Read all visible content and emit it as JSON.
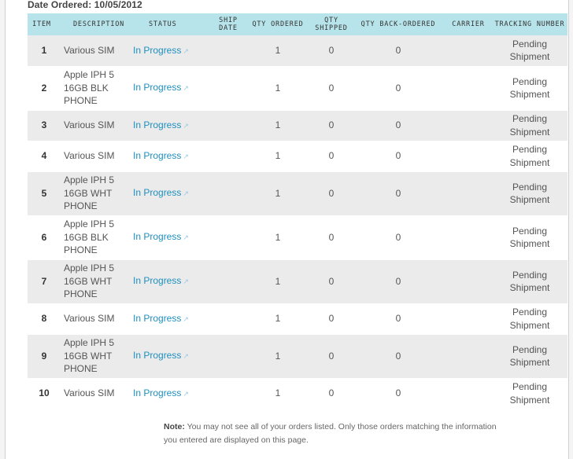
{
  "header": {
    "date_ordered_label": "Date Ordered:",
    "date_ordered_value": "10/05/2012"
  },
  "columns": {
    "item": "Item",
    "description": "Description",
    "status": "Status",
    "ship_date": "Ship Date",
    "qty_ordered": "Qty Ordered",
    "qty_shipped": "Qty Shipped",
    "qty_backordered": "Qty Back-Ordered",
    "carrier": "Carrier",
    "tracking": "Tracking Number"
  },
  "rows": [
    {
      "item": "1",
      "description": "Various SIM",
      "status": "In Progress",
      "ship_date": "",
      "qty_ordered": "1",
      "qty_shipped": "0",
      "qty_backordered": "0",
      "carrier": "",
      "tracking": "Pending Shipment"
    },
    {
      "item": "2",
      "description": "Apple IPH 5 16GB BLK PHONE",
      "status": "In Progress",
      "ship_date": "",
      "qty_ordered": "1",
      "qty_shipped": "0",
      "qty_backordered": "0",
      "carrier": "",
      "tracking": "Pending Shipment"
    },
    {
      "item": "3",
      "description": "Various SIM",
      "status": "In Progress",
      "ship_date": "",
      "qty_ordered": "1",
      "qty_shipped": "0",
      "qty_backordered": "0",
      "carrier": "",
      "tracking": "Pending Shipment"
    },
    {
      "item": "4",
      "description": "Various SIM",
      "status": "In Progress",
      "ship_date": "",
      "qty_ordered": "1",
      "qty_shipped": "0",
      "qty_backordered": "0",
      "carrier": "",
      "tracking": "Pending Shipment"
    },
    {
      "item": "5",
      "description": "Apple IPH 5 16GB WHT PHONE",
      "status": "In Progress",
      "ship_date": "",
      "qty_ordered": "1",
      "qty_shipped": "0",
      "qty_backordered": "0",
      "carrier": "",
      "tracking": "Pending Shipment"
    },
    {
      "item": "6",
      "description": "Apple IPH 5 16GB BLK PHONE",
      "status": "In Progress",
      "ship_date": "",
      "qty_ordered": "1",
      "qty_shipped": "0",
      "qty_backordered": "0",
      "carrier": "",
      "tracking": "Pending Shipment"
    },
    {
      "item": "7",
      "description": "Apple IPH 5 16GB WHT PHONE",
      "status": "In Progress",
      "ship_date": "",
      "qty_ordered": "1",
      "qty_shipped": "0",
      "qty_backordered": "0",
      "carrier": "",
      "tracking": "Pending Shipment"
    },
    {
      "item": "8",
      "description": "Various SIM",
      "status": "In Progress",
      "ship_date": "",
      "qty_ordered": "1",
      "qty_shipped": "0",
      "qty_backordered": "0",
      "carrier": "",
      "tracking": "Pending Shipment"
    },
    {
      "item": "9",
      "description": "Apple IPH 5 16GB WHT PHONE",
      "status": "In Progress",
      "ship_date": "",
      "qty_ordered": "1",
      "qty_shipped": "0",
      "qty_backordered": "0",
      "carrier": "",
      "tracking": "Pending Shipment"
    },
    {
      "item": "10",
      "description": "Various SIM",
      "status": "In Progress",
      "ship_date": "",
      "qty_ordered": "1",
      "qty_shipped": "0",
      "qty_backordered": "0",
      "carrier": "",
      "tracking": "Pending Shipment"
    }
  ],
  "note": {
    "label": "Note:",
    "text": "You may not see all of your orders listed. Only those orders matching the information you entered are displayed on this page."
  },
  "icons": {
    "status_link": "external-link-icon"
  },
  "colors": {
    "header_bg": "#b7e4ea",
    "alt_row_bg": "#ebebeb",
    "link": "#1f8fbf"
  }
}
